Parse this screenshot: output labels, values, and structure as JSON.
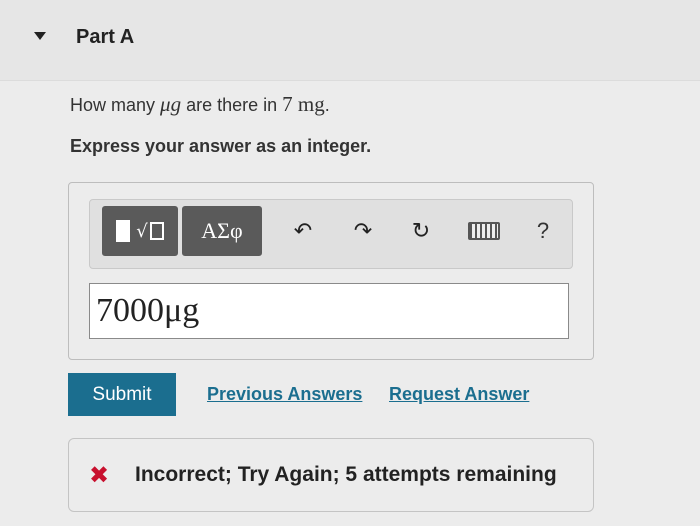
{
  "part": {
    "title": "Part A"
  },
  "question": {
    "prefix": "How many ",
    "unit": "μg",
    "middle": " are there in ",
    "amount": "7 mg",
    "suffix": "."
  },
  "instruction": "Express your answer as an integer.",
  "toolbar": {
    "templates_icon": "templates-icon",
    "symbols_label": "ΑΣφ",
    "undo_icon": "↶",
    "redo_icon": "↷",
    "reset_icon": "↻",
    "keyboard_icon": "keyboard-icon",
    "help_label": "?"
  },
  "answer": {
    "value": "7000μg"
  },
  "actions": {
    "submit_label": "Submit",
    "previous_answers_label": "Previous Answers",
    "request_answer_label": "Request Answer"
  },
  "feedback": {
    "icon": "✖",
    "message": "Incorrect; Try Again; 5 attempts remaining",
    "color": "#c8102e"
  },
  "colors": {
    "accent": "#1b6e8f",
    "error": "#c8102e"
  }
}
